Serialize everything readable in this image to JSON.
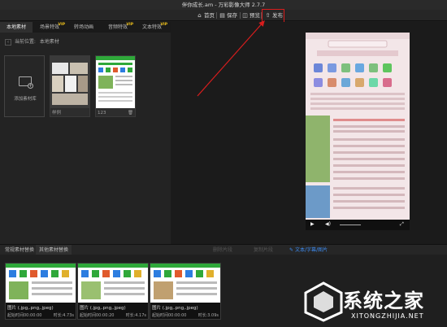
{
  "window": {
    "title": "伴你成长.am - 万彩影像大师 2.7.7"
  },
  "toolbar": {
    "home": "首页",
    "save": "保存",
    "preview": "预览",
    "publish": "发布"
  },
  "left_tabs": {
    "items": [
      {
        "label": "本地素材",
        "vip": false
      },
      {
        "label": "场景特效",
        "vip": true
      },
      {
        "label": "转场动画",
        "vip": false
      },
      {
        "label": "音频特效",
        "vip": true
      },
      {
        "label": "文本特效",
        "vip": true
      }
    ],
    "vip_badge": "VIP"
  },
  "path": {
    "label": "当前位置:",
    "value": "本地素材"
  },
  "library": {
    "add_label": "添加素材库",
    "items": [
      {
        "caption": "样例"
      },
      {
        "caption": "123"
      }
    ]
  },
  "preview_controls": {
    "play": "▶",
    "volume": "◀)",
    "fullscreen": "⤢"
  },
  "bottom_bar": {
    "tabs": [
      "常规素材替换",
      "其他素材替换"
    ],
    "actions": [
      "删除片段",
      "复制片段",
      "文本/字幕/图片"
    ]
  },
  "clips": [
    {
      "name": "图片 (.jpg,.png,.jpeg)",
      "start": "起始时间00:00:00",
      "duration": "时长:4.73s"
    },
    {
      "name": "图片 (.jpg,.png,.jpeg)",
      "start": "起始时间00:00:20",
      "duration": "时长:4.17s"
    },
    {
      "name": "图片 (.jpg,.png,.jpeg)",
      "start": "起始时间00:00:00",
      "duration": "时长:3.09s"
    }
  ],
  "watermark": {
    "brand": "系统之家",
    "url": "XITONGZHIJIA.NET"
  },
  "colors": {
    "accent": "#3d8bf0",
    "highlight": "#d81d1d",
    "vip": "#f2c41a"
  }
}
